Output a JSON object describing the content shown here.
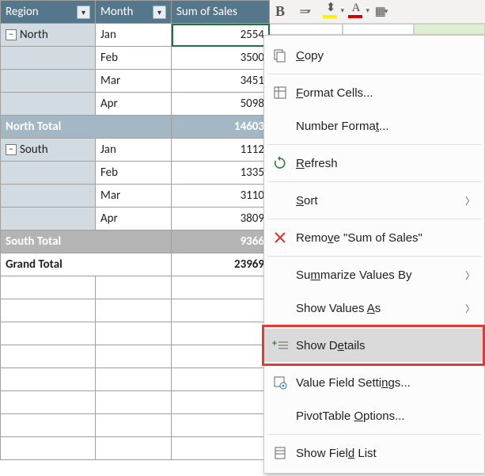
{
  "headers": {
    "region": "Region",
    "month": "Month",
    "sales": "Sum of Sales"
  },
  "regions": [
    {
      "name": "North",
      "months": [
        {
          "m": "Jan",
          "v": "2554"
        },
        {
          "m": "Feb",
          "v": "3500"
        },
        {
          "m": "Mar",
          "v": "3451"
        },
        {
          "m": "Apr",
          "v": "5098"
        }
      ],
      "total_label": "North Total",
      "total": "14603"
    },
    {
      "name": "South",
      "months": [
        {
          "m": "Jan",
          "v": "1112"
        },
        {
          "m": "Feb",
          "v": "1335"
        },
        {
          "m": "Mar",
          "v": "3110"
        },
        {
          "m": "Apr",
          "v": "3809"
        }
      ],
      "total_label": "South Total",
      "total": "9366"
    }
  ],
  "grand": {
    "label": "Grand Total",
    "value": "23969"
  },
  "menu": {
    "copy": "Copy",
    "format_cells": "Format Cells...",
    "number_format": "Number Format...",
    "refresh": "Refresh",
    "sort": "Sort",
    "remove": "Remove \"Sum of Sales\"",
    "summarize": "Summarize Values By",
    "show_values_as": "Show Values As",
    "show_details": "Show Details",
    "value_field_settings": "Value Field Settings...",
    "pivot_options": "PivotTable Options...",
    "show_field_list": "Show Field List"
  },
  "icons": {
    "bold": "B",
    "align": "═",
    "highlight": "✎",
    "font_color": "A",
    "borders": "▦"
  }
}
